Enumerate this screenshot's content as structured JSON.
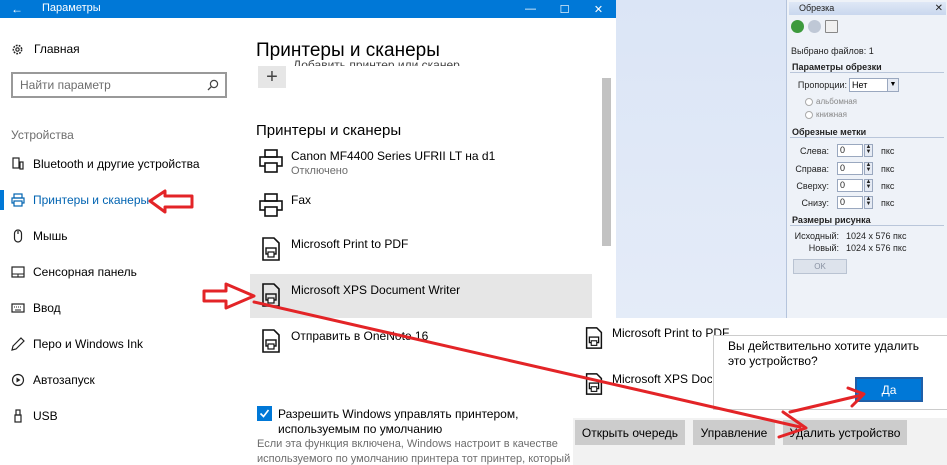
{
  "window": {
    "title": "Параметры",
    "back_glyph": "←",
    "minimize_glyph": "—",
    "maximize_glyph": "☐",
    "close_glyph": "✕"
  },
  "nav": {
    "home_label": "Главная",
    "search_placeholder": "Найти параметр",
    "section_label": "Устройства",
    "items": [
      {
        "label": "Bluetooth и другие устройства",
        "icon": "bluetooth-icon"
      },
      {
        "label": "Принтеры и сканеры",
        "icon": "printer-icon",
        "active": true
      },
      {
        "label": "Мышь",
        "icon": "mouse-icon"
      },
      {
        "label": "Сенсорная панель",
        "icon": "touchpad-icon"
      },
      {
        "label": "Ввод",
        "icon": "keyboard-icon"
      },
      {
        "label": "Перо и Windows Ink",
        "icon": "pen-icon"
      },
      {
        "label": "Автозапуск",
        "icon": "autoplay-icon"
      },
      {
        "label": "USB",
        "icon": "usb-icon"
      }
    ]
  },
  "content": {
    "title": "Принтеры и сканеры",
    "add_label": "Добавить принтер или сканер",
    "section_title": "Принтеры и сканеры",
    "printers": [
      {
        "name": "Canon MF4400 Series UFRII LT на d1",
        "status": "Отключено"
      },
      {
        "name": "Fax",
        "status": ""
      },
      {
        "name": "Microsoft Print to PDF",
        "status": ""
      },
      {
        "name": "Microsoft XPS Document Writer",
        "status": "",
        "selected": true
      },
      {
        "name": "Отправить в OneNote 16",
        "status": ""
      }
    ],
    "checkbox_label": "Разрешить Windows управлять принтером, используемым по умолчанию",
    "description": "Если эта функция включена, Windows настроит в качестве используемого по умолчанию принтера тот принтер, который"
  },
  "popup": {
    "items": [
      "Microsoft Print to PDF",
      "Microsoft XPS Document Writer"
    ],
    "buttons": {
      "open_queue": "Открыть очередь",
      "manage": "Управление",
      "remove": "Удалить устройство"
    }
  },
  "confirm": {
    "question": "Вы действительно хотите удалить это устройство?",
    "yes": "Да"
  },
  "crop_panel": {
    "title": "Обрезка",
    "close_glyph": "✕",
    "selected_files": "Выбрано файлов: 1",
    "crop_params_title": "Параметры обрезки",
    "proportions_label": "Пропорции:",
    "proportions_value": "Нет",
    "landscape": "альбомная",
    "portrait": "книжная",
    "marks_title": "Обрезные метки",
    "fields": [
      {
        "label": "Слева:",
        "value": "0",
        "unit": "пкс"
      },
      {
        "label": "Справа:",
        "value": "0",
        "unit": "пкс"
      },
      {
        "label": "Сверху:",
        "value": "0",
        "unit": "пкс"
      },
      {
        "label": "Снизу:",
        "value": "0",
        "unit": "пкс"
      }
    ],
    "size_title": "Размеры рисунка",
    "original_label": "Исходный:",
    "original_value": "1024 x 576 пкс",
    "new_label": "Новый:",
    "new_value": "1024 x 576 пкс",
    "ok": "OK"
  },
  "colors": {
    "accent": "#0078d7",
    "arrow": "#e32427"
  }
}
